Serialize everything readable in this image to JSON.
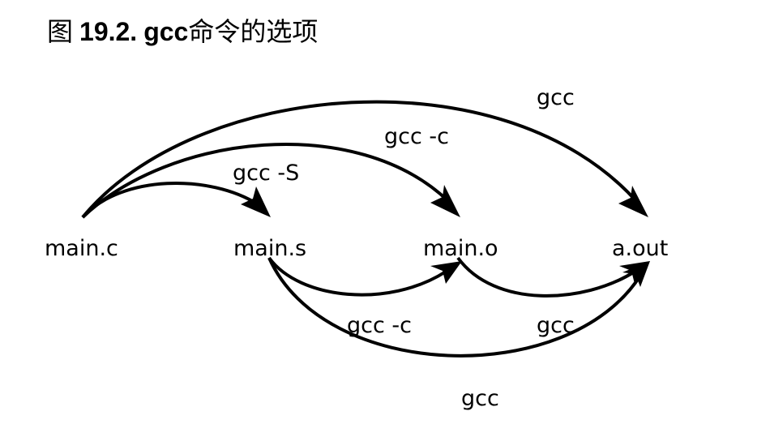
{
  "figure": {
    "prefix": "图",
    "number": "19.2.",
    "title_bold": "gcc",
    "title_rest": "命令的选项"
  },
  "nodes": {
    "main_c": "main.c",
    "main_s": "main.s",
    "main_o": "main.o",
    "a_out": "a.out"
  },
  "edges": {
    "c_to_s": "gcc -S",
    "c_to_o": "gcc -c",
    "c_to_out": "gcc",
    "s_to_o": "gcc -c",
    "o_to_out": "gcc",
    "s_to_out": "gcc"
  },
  "colors": {
    "line": "#000000",
    "background": "#ffffff"
  }
}
